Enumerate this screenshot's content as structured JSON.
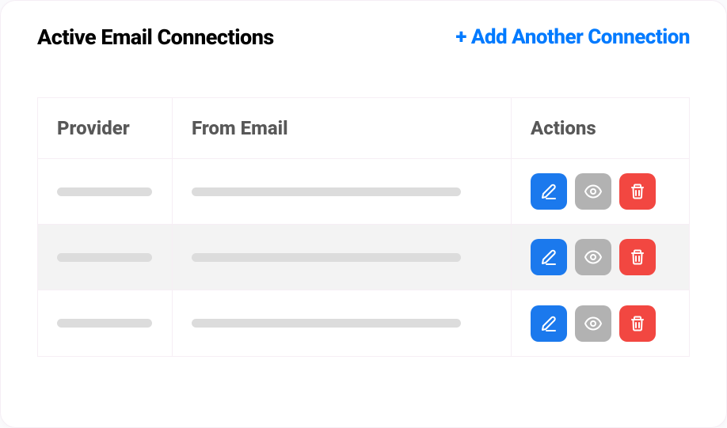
{
  "header": {
    "title": "Active Email Connections",
    "add_link": "+ Add Another Connection"
  },
  "table": {
    "columns": {
      "provider": "Provider",
      "from_email": "From Email",
      "actions": "Actions"
    },
    "rows": [
      {
        "provider": "",
        "from_email": "",
        "alt": false
      },
      {
        "provider": "",
        "from_email": "",
        "alt": true
      },
      {
        "provider": "",
        "from_email": "",
        "alt": false
      }
    ]
  },
  "icons": {
    "edit": "pencil-icon",
    "view": "eye-icon",
    "delete": "trash-icon"
  },
  "colors": {
    "primary": "#007aff",
    "edit_btn": "#1b79ed",
    "view_btn": "#b2b2b2",
    "delete_btn": "#f24741"
  }
}
